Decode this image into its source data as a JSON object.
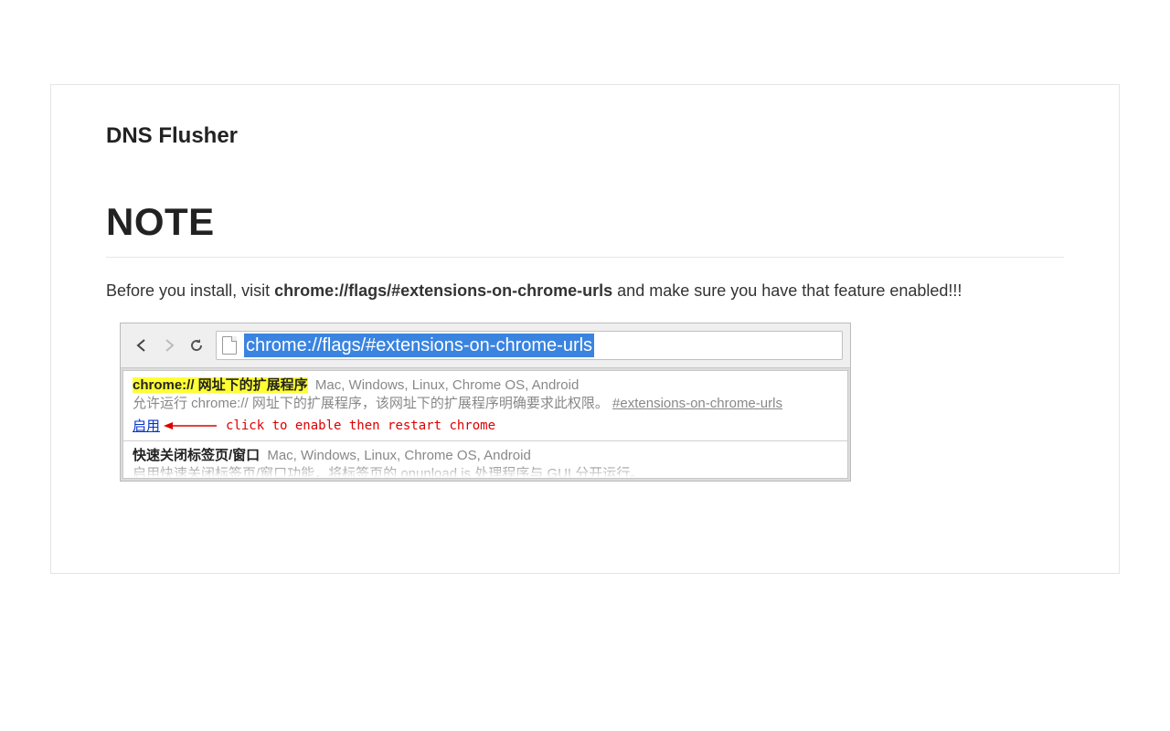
{
  "title": "DNS Flusher",
  "note_heading": "NOTE",
  "intro": {
    "before": "Before you install, visit ",
    "url": "chrome://flags/#extensions-on-chrome-urls",
    "after": " and make sure you have that feature enabled!!!"
  },
  "screenshot": {
    "address_bar": "chrome://flags/#extensions-on-chrome-urls",
    "flag1": {
      "name": "chrome:// 网址下的扩展程序",
      "platforms": "Mac, Windows, Linux, Chrome OS, Android",
      "description": "允许运行 chrome:// 网址下的扩展程序，该网址下的扩展程序明确要求此权限。",
      "anchor": "#extensions-on-chrome-urls",
      "enable_label": "启用",
      "red_note": "click to enable then restart chrome"
    },
    "flag2": {
      "name": "快速关闭标签页/窗口",
      "platforms": "Mac, Windows, Linux, Chrome OS, Android",
      "description_partial": "启用快速关闭标签页/窗口功能，将标签页的 onunload js 处理程序与 GUI 分开运行。"
    }
  }
}
